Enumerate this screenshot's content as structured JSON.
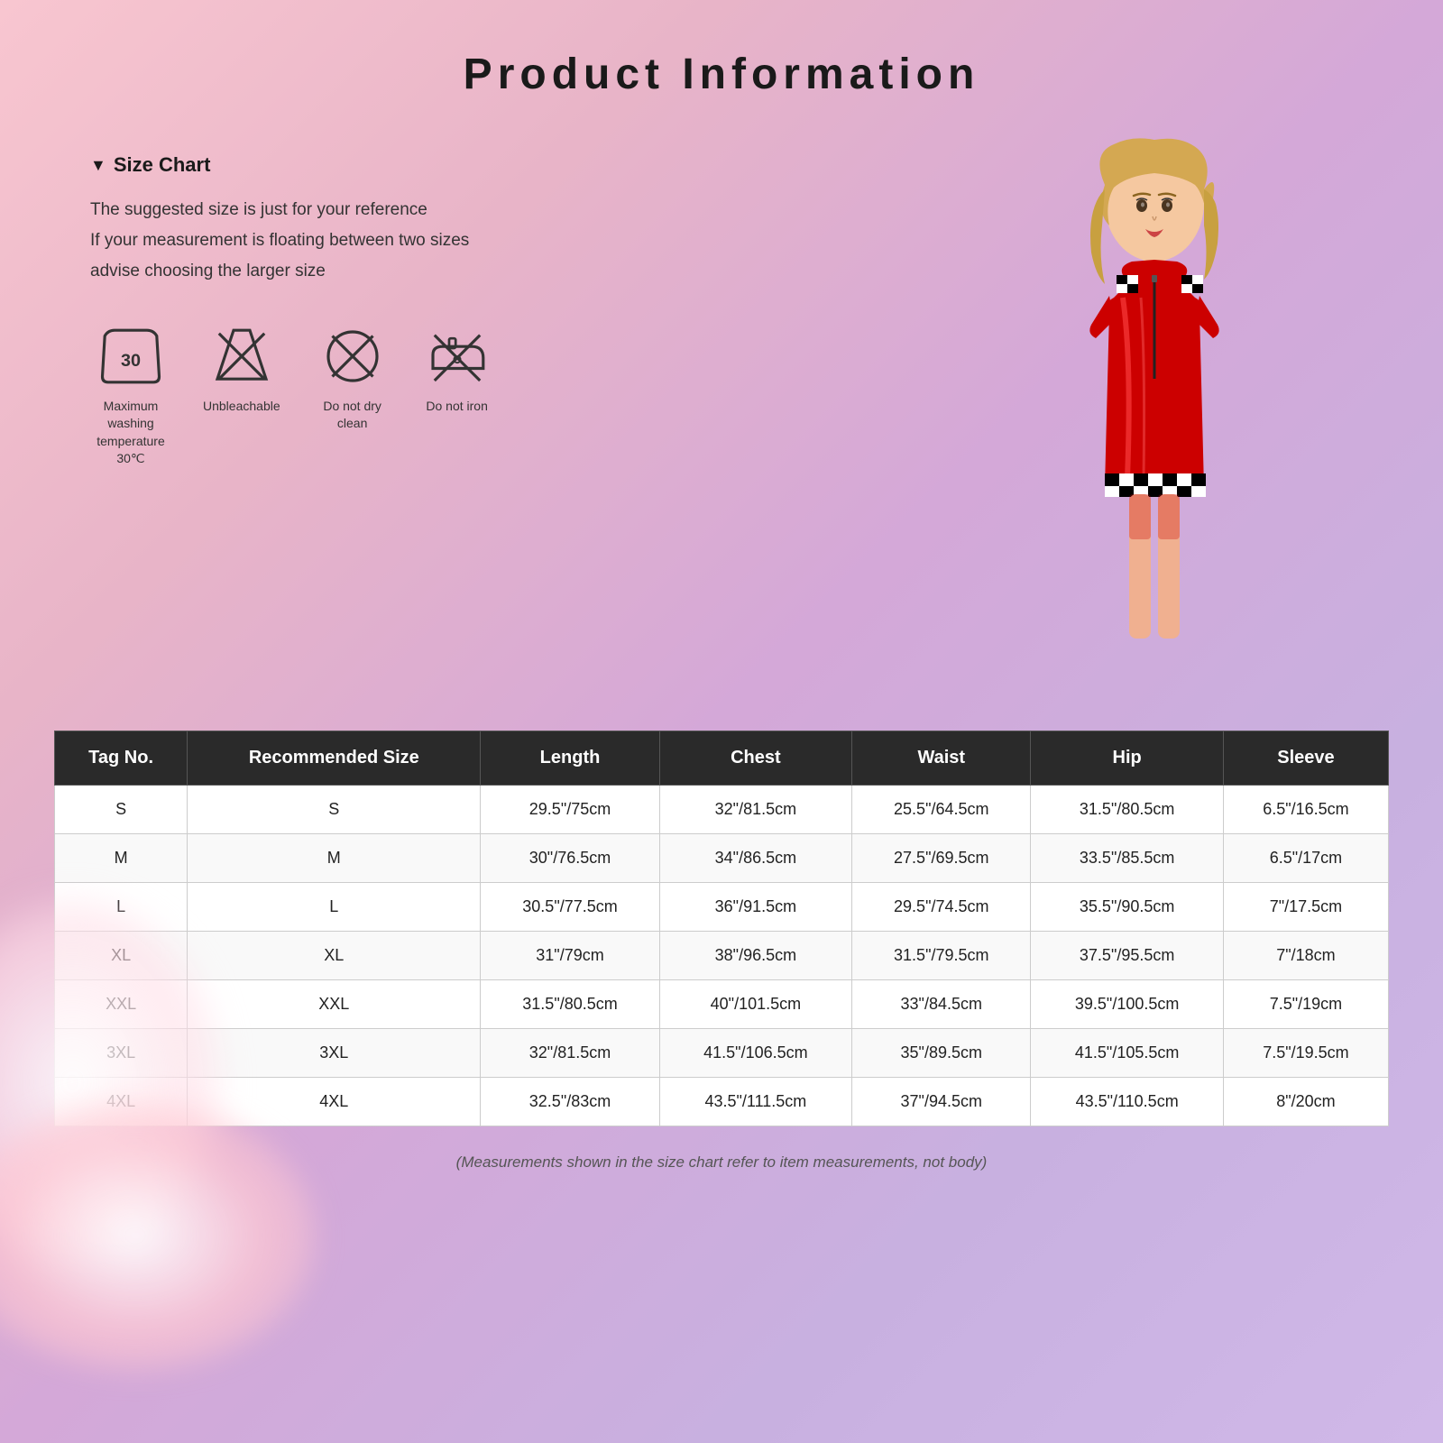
{
  "page": {
    "title": "Product   Information",
    "background_colors": [
      "#f8c6d0",
      "#d4a8d8",
      "#c8b0e0"
    ]
  },
  "size_chart": {
    "section_title": "Size Chart",
    "description_lines": [
      "The suggested size is just for your reference",
      "If your measurement is floating between two sizes",
      "advise choosing the larger size"
    ]
  },
  "care_icons": [
    {
      "id": "wash",
      "label": "Maximum washing\ntemperature 30℃",
      "type": "wash-30"
    },
    {
      "id": "bleach",
      "label": "Unbleachable",
      "type": "no-bleach"
    },
    {
      "id": "dryclean",
      "label": "Do not dry clean",
      "type": "no-dryclean"
    },
    {
      "id": "iron",
      "label": "Do not iron",
      "type": "no-iron"
    }
  ],
  "table": {
    "headers": [
      "Tag No.",
      "Recommended Size",
      "Length",
      "Chest",
      "Waist",
      "Hip",
      "Sleeve"
    ],
    "rows": [
      [
        "S",
        "S",
        "29.5\"/75cm",
        "32\"/81.5cm",
        "25.5\"/64.5cm",
        "31.5\"/80.5cm",
        "6.5\"/16.5cm"
      ],
      [
        "M",
        "M",
        "30\"/76.5cm",
        "34\"/86.5cm",
        "27.5\"/69.5cm",
        "33.5\"/85.5cm",
        "6.5\"/17cm"
      ],
      [
        "L",
        "L",
        "30.5\"/77.5cm",
        "36\"/91.5cm",
        "29.5\"/74.5cm",
        "35.5\"/90.5cm",
        "7\"/17.5cm"
      ],
      [
        "XL",
        "XL",
        "31\"/79cm",
        "38\"/96.5cm",
        "31.5\"/79.5cm",
        "37.5\"/95.5cm",
        "7\"/18cm"
      ],
      [
        "XXL",
        "XXL",
        "31.5\"/80.5cm",
        "40\"/101.5cm",
        "33\"/84.5cm",
        "39.5\"/100.5cm",
        "7.5\"/19cm"
      ],
      [
        "3XL",
        "3XL",
        "32\"/81.5cm",
        "41.5\"/106.5cm",
        "35\"/89.5cm",
        "41.5\"/105.5cm",
        "7.5\"/19.5cm"
      ],
      [
        "4XL",
        "4XL",
        "32.5\"/83cm",
        "43.5\"/111.5cm",
        "37\"/94.5cm",
        "43.5\"/110.5cm",
        "8\"/20cm"
      ]
    ]
  },
  "footer_note": "(Measurements shown in the size chart refer to item measurements, not body)"
}
